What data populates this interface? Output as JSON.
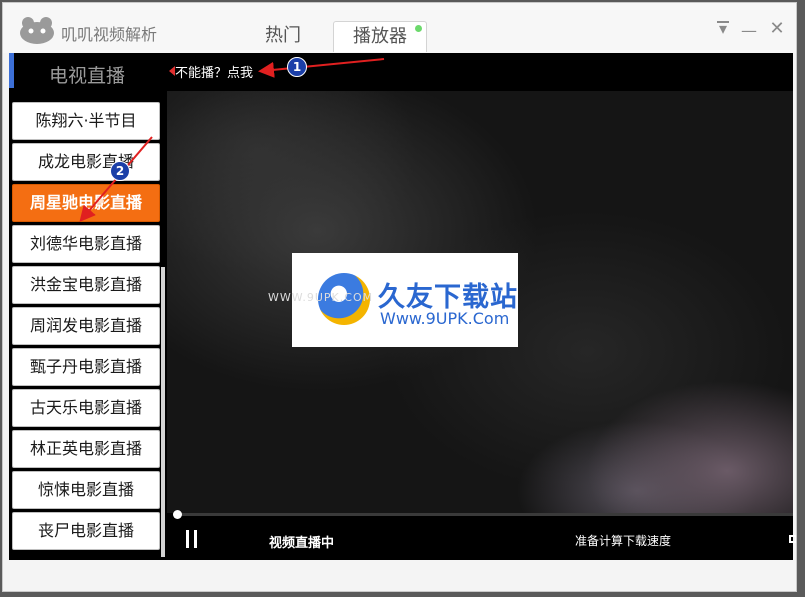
{
  "app": {
    "title": "叽叽视频解析"
  },
  "tabs": [
    {
      "label": "热门"
    },
    {
      "label": "播放器"
    }
  ],
  "sidebar": {
    "title": "电视直播",
    "channels": [
      {
        "label": "陈翔六·半节目"
      },
      {
        "label": "成龙电影直播"
      },
      {
        "label": "周星驰电影直播",
        "active": true
      },
      {
        "label": "刘德华电影直播"
      },
      {
        "label": "洪金宝电影直播"
      },
      {
        "label": "周润发电影直播"
      },
      {
        "label": "甄子丹电影直播"
      },
      {
        "label": "古天乐电影直播"
      },
      {
        "label": "林正英电影直播"
      },
      {
        "label": "惊悚电影直播"
      },
      {
        "label": "丧尸电影直播"
      }
    ]
  },
  "player": {
    "help_link": "不能播？点我",
    "status": "视频直播中",
    "download_speed": "准备计算下载速度"
  },
  "watermark": {
    "title": "久友下载站",
    "url": "Www.9UPK.Com",
    "overlay": "WWW.9UPK.COM"
  },
  "annotations": [
    {
      "number": "1"
    },
    {
      "number": "2"
    }
  ],
  "colors": {
    "active_channel": "#f46e12",
    "sidebar_accent": "#3c6fd6",
    "annotation_arrow": "#e02020",
    "annotation_badge": "#1b3fa8"
  }
}
